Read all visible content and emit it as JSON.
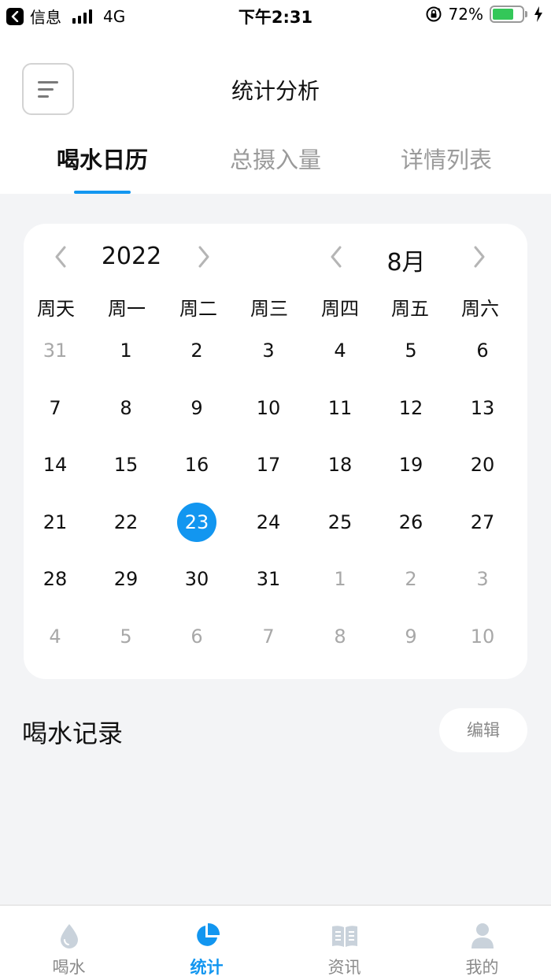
{
  "status_bar": {
    "carrier": "信息",
    "network": "4G",
    "time": "下午2:31",
    "battery": "72%",
    "battery_level": 0.72,
    "icons": [
      "back-icon",
      "signal-icon",
      "rotation-lock-icon",
      "battery-icon",
      "charging-icon"
    ]
  },
  "header": {
    "title": "统计分析",
    "menu_icon": "menu-icon",
    "tabs": [
      {
        "label": "喝水日历",
        "active": true
      },
      {
        "label": "总摄入量",
        "active": false
      },
      {
        "label": "详情列表",
        "active": false
      }
    ]
  },
  "calendar": {
    "year": "2022",
    "month": "8月",
    "weekdays": [
      "周天",
      "周一",
      "周二",
      "周三",
      "周四",
      "周五",
      "周六"
    ],
    "selected_day": "23",
    "weeks": [
      [
        {
          "d": "31",
          "other": true
        },
        {
          "d": "1"
        },
        {
          "d": "2"
        },
        {
          "d": "3"
        },
        {
          "d": "4"
        },
        {
          "d": "5"
        },
        {
          "d": "6"
        }
      ],
      [
        {
          "d": "7"
        },
        {
          "d": "8"
        },
        {
          "d": "9"
        },
        {
          "d": "10"
        },
        {
          "d": "11"
        },
        {
          "d": "12"
        },
        {
          "d": "13"
        }
      ],
      [
        {
          "d": "14"
        },
        {
          "d": "15"
        },
        {
          "d": "16"
        },
        {
          "d": "17"
        },
        {
          "d": "18"
        },
        {
          "d": "19"
        },
        {
          "d": "20"
        }
      ],
      [
        {
          "d": "21"
        },
        {
          "d": "22"
        },
        {
          "d": "23",
          "selected": true
        },
        {
          "d": "24"
        },
        {
          "d": "25"
        },
        {
          "d": "26"
        },
        {
          "d": "27"
        }
      ],
      [
        {
          "d": "28"
        },
        {
          "d": "29"
        },
        {
          "d": "30"
        },
        {
          "d": "31"
        },
        {
          "d": "1",
          "other": true
        },
        {
          "d": "2",
          "other": true
        },
        {
          "d": "3",
          "other": true
        }
      ],
      [
        {
          "d": "4",
          "other": true
        },
        {
          "d": "5",
          "other": true
        },
        {
          "d": "6",
          "other": true
        },
        {
          "d": "7",
          "other": true
        },
        {
          "d": "8",
          "other": true
        },
        {
          "d": "9",
          "other": true
        },
        {
          "d": "10",
          "other": true
        }
      ]
    ]
  },
  "records": {
    "title": "喝水记录",
    "edit_label": "编辑"
  },
  "bottom_nav": [
    {
      "label": "喝水",
      "icon": "water-drop-icon",
      "active": false
    },
    {
      "label": "统计",
      "icon": "pie-chart-icon",
      "active": true
    },
    {
      "label": "资讯",
      "icon": "book-icon",
      "active": false
    },
    {
      "label": "我的",
      "icon": "user-icon",
      "active": false
    }
  ],
  "colors": {
    "accent": "#1296f0",
    "background": "#f3f4f6",
    "inactive": "#8a8a8a"
  }
}
